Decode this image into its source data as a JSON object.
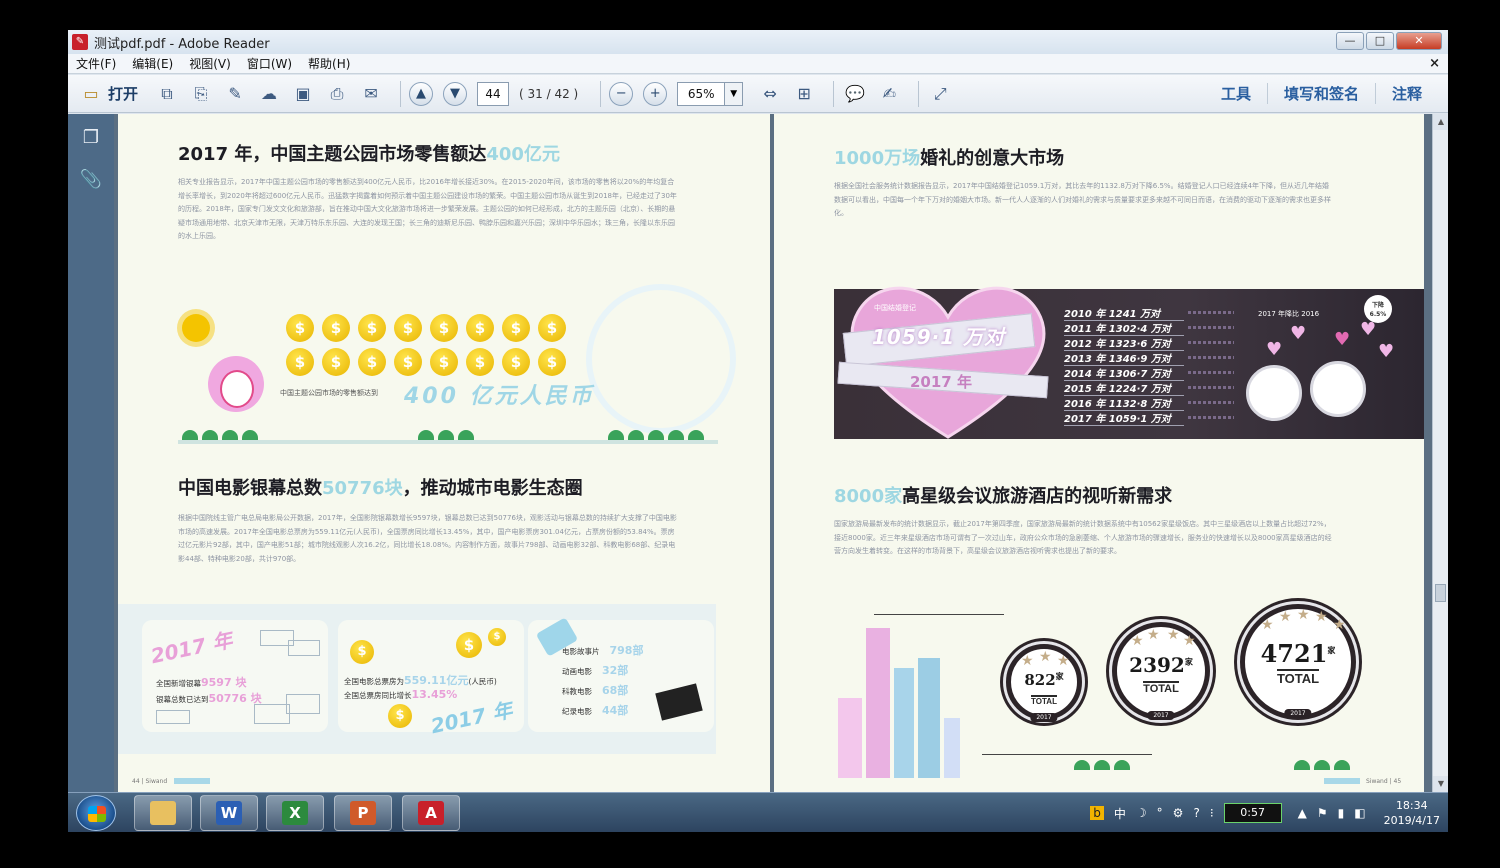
{
  "window": {
    "title": "测试pdf.pdf - Adobe Reader",
    "app_icon": "pdf-icon",
    "controls": {
      "minimize": "—",
      "maximize": "□",
      "close": "✕"
    }
  },
  "menu": {
    "items": [
      "文件(F)",
      "编辑(E)",
      "视图(V)",
      "窗口(W)",
      "帮助(H)"
    ],
    "close": "×"
  },
  "toolbar": {
    "open_label": "打开",
    "page_input": "44",
    "page_count": "( 31 / 42 )",
    "zoom": "65%",
    "right_links": [
      "工具",
      "填写和签名",
      "注释"
    ]
  },
  "left_page": {
    "h1_a": "2017 年，中国主题公园市场零售额达",
    "h1_b": "400亿元",
    "p1": "相关专业报告显示，2017年中国主题公园市场的零售额达到400亿元人民币，比2016年增长接近30%。在2015-2020年间，该市场的零售将以20%的年均复合增长率增长，到2020年将超过600亿元人民币。迅猛数字揭露着如何预示着中国主题公园建设市场的繁荣。中国主题公园市场从诞生到2018年，已经走过了30年的历程。2018年，国家专门发文文化和旅游部，旨在推动中国大文化旅游市场将进一步繁荣发展。主题公园的如何已经形成，北方的主题乐园（北京）、长期的悬疑市场通用地带、北京天津市无限，天津万特乐东乐园、大连的发现王国；长三角的迪斯尼乐园、鸭脖乐园和嘉兴乐园；深圳中华乐园水；珠三角，长隆以东乐园的水上乐园。",
    "coins_row1": [
      "$",
      "$",
      "$",
      "$",
      "$",
      "$",
      "$",
      "$"
    ],
    "coins_row2": [
      "$",
      "$",
      "$",
      "$",
      "$",
      "$",
      "$",
      "$"
    ],
    "caption_small": "中国主题公园市场的零售额达到",
    "caption_big": "400 亿元人民币",
    "h2_a": "中国电影银幕总数",
    "h2_b": "50776块",
    "h2_c": "，推动城市电影生态圈",
    "p2": "根据中国院线主管广电总局电影局公开数据，2017年，全国影院银幕数增长9597块，银幕总数已达到50776块，观影活动与银幕总数的持续扩大支撑了中国电影市场的高速发展。2017年全国电影总票房为559.11亿元(人民币)，全国票房同比增长13.45%，其中，国产电影票房301.04亿元，占票房份额的53.84%。票房过亿元影片92部，其中，国产电影51部；城市院线观影人次16.2亿，同比增长18.08%。内容制作方面，故事片798部、动画电影32部、科教电影68部、纪录电影44部、特种电影20部，共计970部。",
    "card1": {
      "year": "2017 年",
      "line1_label": "全国新增银幕",
      "line1_value": "9597 块",
      "line2_label": "银幕总数已达到",
      "line2_value": "50776 块"
    },
    "card2": {
      "line1_label": "全国电影总票房为",
      "line1_value": "559.11亿元",
      "line1_unit": "(人民币)",
      "line2_label": "全国总票房同比增长",
      "line2_value": "13.45%",
      "year": "2017 年"
    },
    "card3": [
      {
        "label": "电影故事片",
        "value": "798部"
      },
      {
        "label": "动画电影",
        "value": "32部"
      },
      {
        "label": "科教电影",
        "value": "68部"
      },
      {
        "label": "纪录电影",
        "value": "44部"
      }
    ],
    "footer": "44 | Siwand"
  },
  "right_page": {
    "h1_a": "1000万场",
    "h1_b": "婚礼的创意大市场",
    "p1": "根据全国社会服务统计数据报告显示，2017年中国结婚登记1059.1万对，其比去年的1132.8万对下降6.5%。结婚登记人口已经连续4年下降，但从近几年结婚数据可以看出，中国每一个年下万对的婚姻大市场。新一代人人逐渐的人们对婚礼的需求与质量要求更多来越不可同日而语，在消费的驱动下逐渐的需求也更多样化。",
    "banner": {
      "title_small": "中国结婚登记",
      "title_big": "1059·1 万对",
      "year": "2017 年",
      "rows": [
        "2010 年 1241 万对",
        "2011 年 1302·4 万对",
        "2012 年 1323·6 万对",
        "2013 年 1346·9 万对",
        "2014 年 1306·7 万对",
        "2015 年 1224·7 万对",
        "2016 年 1132·8 万对",
        "2017 年 1059·1 万对"
      ],
      "tag_right": "2017 年降比 2016",
      "tag_badge": "下降 6.5%"
    },
    "h2_a": "8000家",
    "h2_b": "高星级会议旅游酒店的视听新需求",
    "p2": "国家旅游局最新发布的统计数据显示，截止2017年第四季度，国家旅游局最新的统计数据系统中有10562家星级饭店。其中三星级酒店以上数量占比超过72%，接近8000家。近三年来星级酒店市场可谓有了一次过山车，政府公众市场的急剧萎缩、个人旅游市场的骤速增长，服务业的快速增长以及8000家高星级酒店的经营方向发生着转变。在这样的市场背景下，高星级会议旅游酒店视听需求也提出了新的要求。",
    "badges": [
      {
        "num": "822",
        "unit": "家",
        "total": "TOTAL",
        "year": "2017"
      },
      {
        "num": "2392",
        "unit": "家",
        "total": "TOTAL",
        "year": "2017"
      },
      {
        "num": "4721",
        "unit": "家",
        "total": "TOTAL",
        "year": "2017"
      }
    ],
    "footer": "Siwand | 45"
  },
  "taskbar": {
    "apps": [
      "folder-icon",
      "word-icon",
      "excel-icon",
      "powerpoint-icon",
      "acrobat-icon"
    ],
    "app_glyphs": [
      "",
      "W",
      "X",
      "P",
      "A"
    ],
    "tray": [
      "b",
      "中",
      "☽",
      "°",
      "⚙",
      "?",
      "⁝"
    ],
    "battery": "0:57",
    "time": "18:34",
    "date": "2019/4/17"
  },
  "colors": {
    "highlight_cyan": "#9ed7e2",
    "pink": "#e8a0d8",
    "dark_banner": "#3a3038",
    "page_bg": "#f7f9ee",
    "nav_blue": "#4d6a87"
  }
}
